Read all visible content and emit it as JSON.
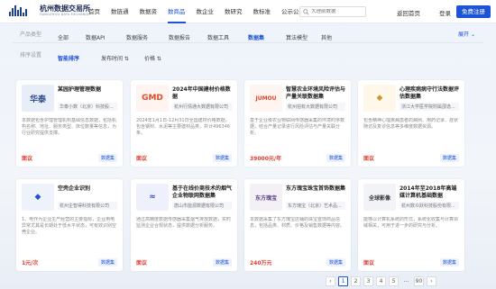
{
  "header": {
    "logo_title": "杭州数据交易所",
    "logo_sub": "HANGZHOU DATA EXCHANGE",
    "nav": [
      "首页",
      "数链通",
      "数据资",
      "数商品",
      "数企业",
      "数研究",
      "数标准",
      "公示公告",
      "帮助中心"
    ],
    "active_nav": 3,
    "search_placeholder": "大理前数据",
    "back_home": "返回首页",
    "login": "登录",
    "register": "免费注册"
  },
  "filters": {
    "type_label": "产品类型",
    "types": [
      "全部",
      "数据API",
      "数据服务",
      "数据报告",
      "数据工具",
      "数据集",
      "算法模型",
      "其他"
    ],
    "selected_type": "数据集",
    "expand": "展开",
    "sort_label": "排序设置",
    "sorts": [
      "智能排序",
      "发布时间",
      "价格"
    ],
    "selected_sort": "智能排序"
  },
  "cards": [
    {
      "title": "某园护理管理数据",
      "company": "华泰小数（北京）科技股...",
      "desc": "本数据包含护理管理机构基础信息数据，包括机构名称、地址、服务类型、床位数量等信息，为行业研究提供支撑。",
      "price": "面议",
      "tag": "数据集",
      "thumb_text": "华泰",
      "thumb_color": "#e8eef8",
      "thumb_fg": "#2c4a8c"
    },
    {
      "title": "2024年中国建材价格数据",
      "company": "杭州行情通大数据有限公司",
      "desc": "2024年1月1日-12月31日全国建材价格数据，包含钢材、水泥等主要建材品类，共计496346条。",
      "price": "面议",
      "tag": "数据集",
      "thumb_text": "GMD",
      "thumb_color": "#fff4f0",
      "thumb_fg": "#e04b2a"
    },
    {
      "title": "智慧农业环境风险评估与产量关联数据集",
      "company": "杭州拍有大数据有限公司",
      "desc": "基于企业级农业物联网传感器采集的环境时序数据，结合产量记录进行风险评估与产量关联分析。",
      "price": "39000元/年",
      "tag": "数据集",
      "thumb_text": "JUMOU",
      "thumb_color": "#fff5f0",
      "thumb_fg": "#e2432e"
    },
    {
      "title": "心理疾病病守行法数据评估数据集",
      "company": "浙江大学医学院附属邵逸...",
      "desc": "包含精神心理疾病患者的病例、用药记录、症状随访及复诊信息等多维度数据资源。",
      "price": "面议",
      "tag": "数据集",
      "thumb_text": "◆",
      "thumb_color": "#fff8ea",
      "thumb_fg": "#c99a2e"
    },
    {
      "title": "空壳企业识别",
      "company": "杭州企智得科技有限公司",
      "desc": "1、电作为企业生产经营的主要指标，企业用电异常尤其是长期处于低水平状态，可有效识别空壳企业。",
      "price": "1元/次",
      "tag": "数据集",
      "thumb_text": "◆",
      "thumb_color": "#eef3fb",
      "thumb_fg": "#1d53d6"
    },
    {
      "title": "基于在线价商技术的烟气企业物联网数据集",
      "company": "唐山市能源数据有限公司",
      "desc": "通过高精度数据传感器采集烟气排放数据，实时监测企业合规状态，提供数据分析服务。",
      "price": "面议",
      "tag": "数据集",
      "thumb_text": "≈",
      "thumb_color": "#eef1fb",
      "thumb_fg": "#3a4fc2"
    },
    {
      "title": "东方瑰宝珠宝首饰数据集",
      "company": "东方瑰宝（北京）艺术品...",
      "desc": "本数据采集了东方瑰宝店铺的珠宝首饰商品信息，包括品类、材质、价格及销售数据等内容。",
      "price": "240万元",
      "tag": "数据集",
      "thumb_text": "东方瑰宝",
      "thumb_color": "#f3f0f6",
      "thumb_fg": "#5a3e8c"
    },
    {
      "title": "2014年至2018年高端媒计算机基础数据",
      "company": "杭州数众跃科技股份有限...",
      "desc": "能够以计算机系统的形式，系统化收集与计算领域相关，可用于进一步的研究与分析。",
      "price": "面议",
      "tag": "数据集",
      "thumb_text": "全球影像",
      "thumb_color": "#f1f3f7",
      "thumb_fg": "#333"
    }
  ],
  "pager": {
    "prev": "‹",
    "pages": [
      "1",
      "2",
      "3",
      "4",
      "5"
    ],
    "current": "1",
    "dots": "...",
    "last": "90",
    "next": "›"
  }
}
